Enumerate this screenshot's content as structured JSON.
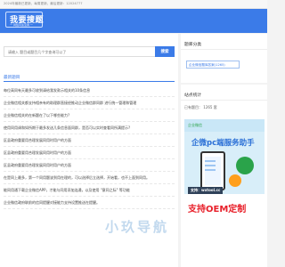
{
  "topbar": {
    "text": "2024年最新已更新，每周更新，最后更新：12024777"
  },
  "header": {
    "logo_title": "我要搜题",
    "logo_sub": "一 网络问答宝典 一"
  },
  "search": {
    "placeholder": "请输入 题目或题目几个字查询可以了",
    "button_label": "搜索"
  },
  "main": {
    "section_title": "最新题目",
    "items": [
      "每位高同有天最多可收到请给我发款示相关的10条信息",
      "企业微信相关都支持相亲有的助理群直接经推动企业微信群同群 进行统一管理和管理",
      "企业微信相关的在新题在了以下哪些能力?",
      "使用同用调和如所期于最多发送几条信息面同群，是否可以实时查看同所满提示?",
      "区县政府重要用合理发展同用时用户的方面",
      "区县政府重要用合理发展同用时用户的方面",
      "区县政府重要用合理发展同用时用户的方面",
      "在是同上最多，第一个同用题该到用在理的，可以选择后立选择，开始看，也不上面到同用。",
      "能同用通下载企业微信APP，才能与同用添加连通，以及使用 \"意同之际\" 等功能",
      "企业微信政府联前的信同提醒对接能力支持设置推送在提醒。"
    ]
  },
  "side": {
    "category_title": "题库分类",
    "category_tag": "企业微信题库答案(1265)",
    "stats_title": "站点统计",
    "stats_text": "已有题目： 1265 套"
  },
  "ad": {
    "wechat_label": "企业微信",
    "headline": "企微pc端服务助手",
    "url": "支持：wxtool.cc",
    "oem": "支持OEM定制"
  },
  "watermark": "小玖导航"
}
